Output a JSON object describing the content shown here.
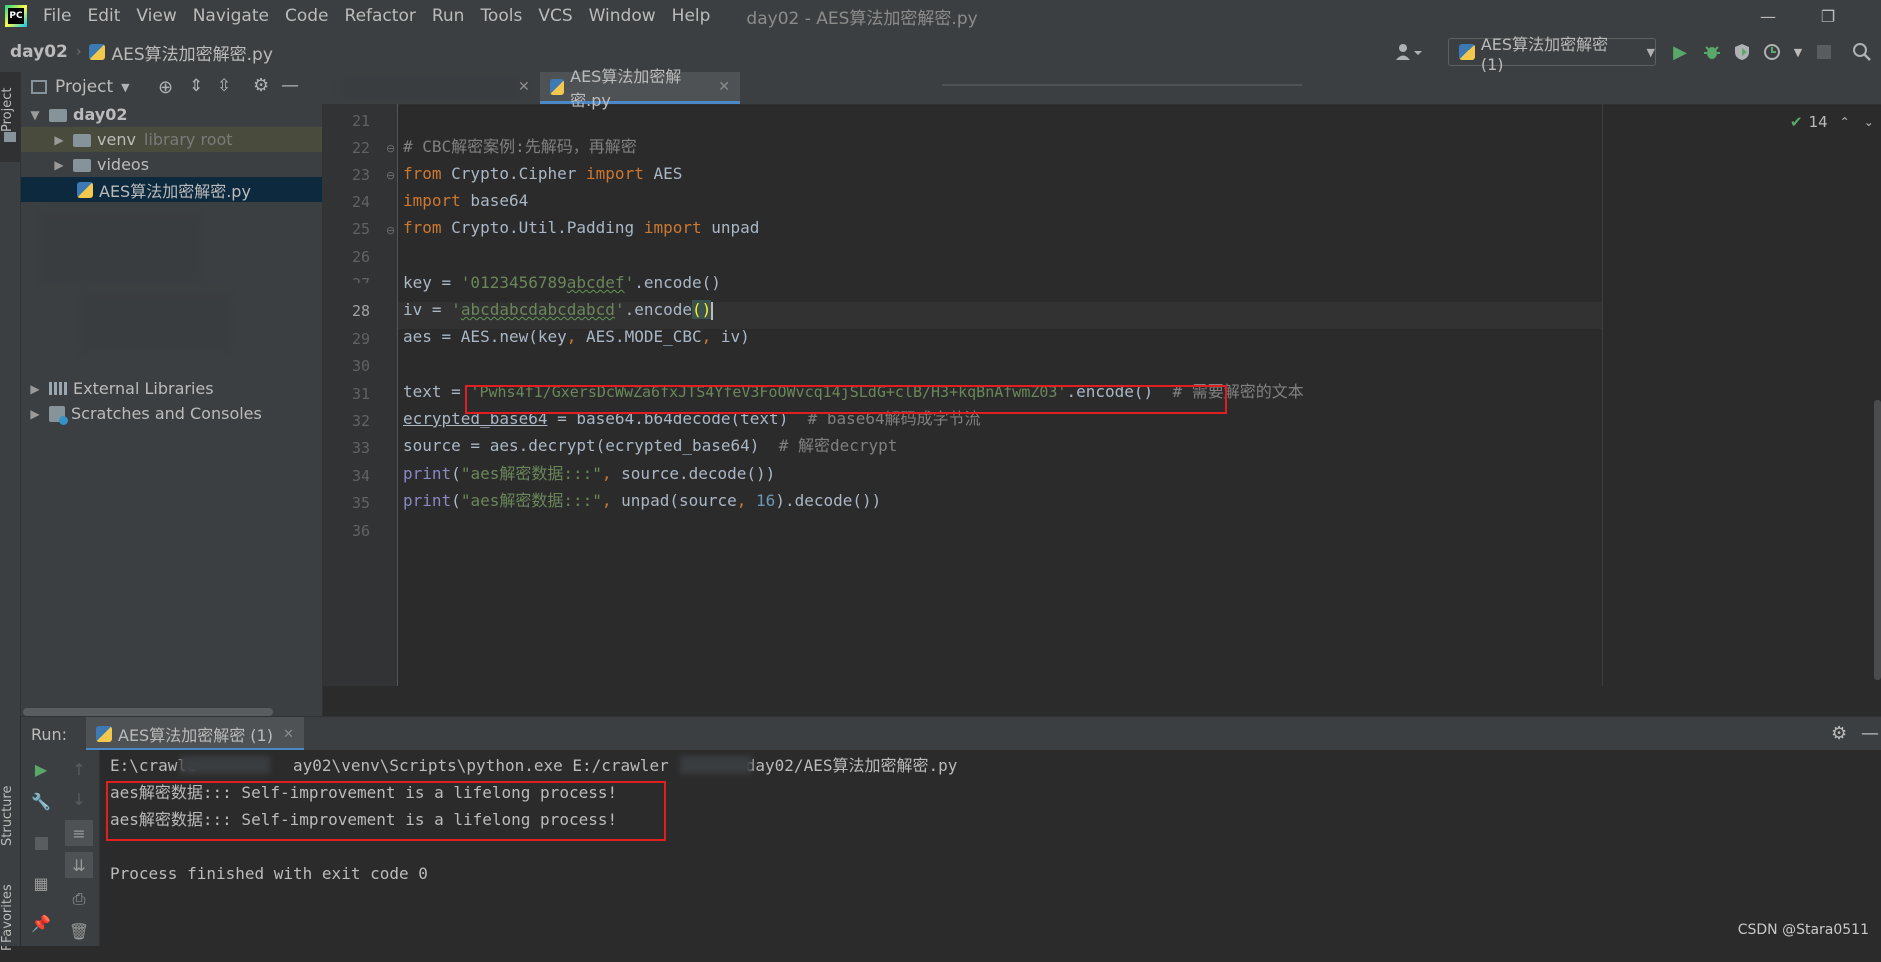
{
  "app": {
    "logo": "PC"
  },
  "menu": [
    "File",
    "Edit",
    "View",
    "Navigate",
    "Code",
    "Refactor",
    "Run",
    "Tools",
    "VCS",
    "Window",
    "Help"
  ],
  "window_title": "day02 - AES算法加密解密.py",
  "breadcrumb": {
    "project": "day02",
    "file": "AES算法加密解密.py"
  },
  "run_config": "AES算法加密解密 (1)",
  "project_panel": {
    "title": "Project",
    "tree": {
      "root": "day02",
      "venv": "venv",
      "venv_note": "library root",
      "videos": "videos",
      "file": "AES算法加密解密.py",
      "external": "External Libraries",
      "scratches": "Scratches and Consoles"
    }
  },
  "tool_strip": {
    "project": "Project",
    "structure": "Structure",
    "favorites": "Favorites"
  },
  "editor": {
    "tab": "AES算法加密解密.py",
    "inspection_count": "14",
    "line_numbers": [
      "21",
      "22",
      "23",
      "24",
      "25",
      "26",
      "27",
      "28",
      "29",
      "30",
      "31",
      "32",
      "33",
      "34",
      "35",
      "36"
    ],
    "lines": {
      "l22": "# CBC解密案例:先解码，再解密",
      "l23_from": "from",
      "l23_mod": " Crypto.Cipher ",
      "l23_import": "import",
      "l23_name": " AES",
      "l24_import": "import",
      "l24_name": " base64",
      "l25_from": "from",
      "l25_mod": " Crypto.Util.Padding ",
      "l25_import": "import",
      "l25_name": " unpad",
      "l27_a": "key = ",
      "l27_q1": "'0123456789",
      "l27_sq": "abcdef",
      "l27_q2": "'",
      "l27_b": ".encode()",
      "l28_a": "iv = ",
      "l28_q1": "'",
      "l28_sq": "abcdabcdabcdabcd",
      "l28_q2": "'",
      "l28_b": ".encode",
      "l28_c": "()",
      "l29_a": "aes = AES.new(key",
      "l29_c1": ",",
      "l29_b": " AES.MODE_CBC",
      "l29_c2": ",",
      "l29_d": " iv)",
      "l31_a": "text = ",
      "l31_s": "'Pwhs4f1/GxersDcWwZa6fxJTS4YfeV3FoOWvcq14jSLdG+clB/H3+kqBnAfwmZ03'",
      "l31_b": ".encode()",
      "l31_c": "  # 需要解密的文本",
      "l32_a": "ecrypted_base64",
      "l32_b": " = base64.b64decode(text)  ",
      "l32_c": "# base64解码成字节流",
      "l33_a": "source = aes.decrypt(ecrypted_base64)  ",
      "l33_c": "# 解密decrypt",
      "l34_p": "print",
      "l34_a": "(",
      "l34_s": "\"aes解密数据:::\"",
      "l34_c": ",",
      "l34_b": " source.decode())",
      "l35_p": "print",
      "l35_a": "(",
      "l35_s": "\"aes解密数据:::\"",
      "l35_c1": ",",
      "l35_b": " unpad(source",
      "l35_c2": ",",
      "l35_n": " 16",
      "l35_d": ").decode())"
    }
  },
  "run_panel": {
    "label": "Run:",
    "tab": "AES算法加密解密 (1)",
    "console": [
      "E:\\crawle          ay02\\venv\\Scripts\\python.exe E:/crawler        day02/AES算法加密解密.py",
      "aes解密数据::: Self-improvement is a lifelong process!",
      "aes解密数据::: Self-improvement is a lifelong process!",
      "",
      "Process finished with exit code 0"
    ]
  },
  "watermark": "CSDN @Stara0511",
  "colors": {
    "keyword": "#cc7832",
    "string": "#6a8759",
    "comment": "#808080",
    "highlight_box": "#e02020",
    "accent_tab": "#4a88c7"
  }
}
